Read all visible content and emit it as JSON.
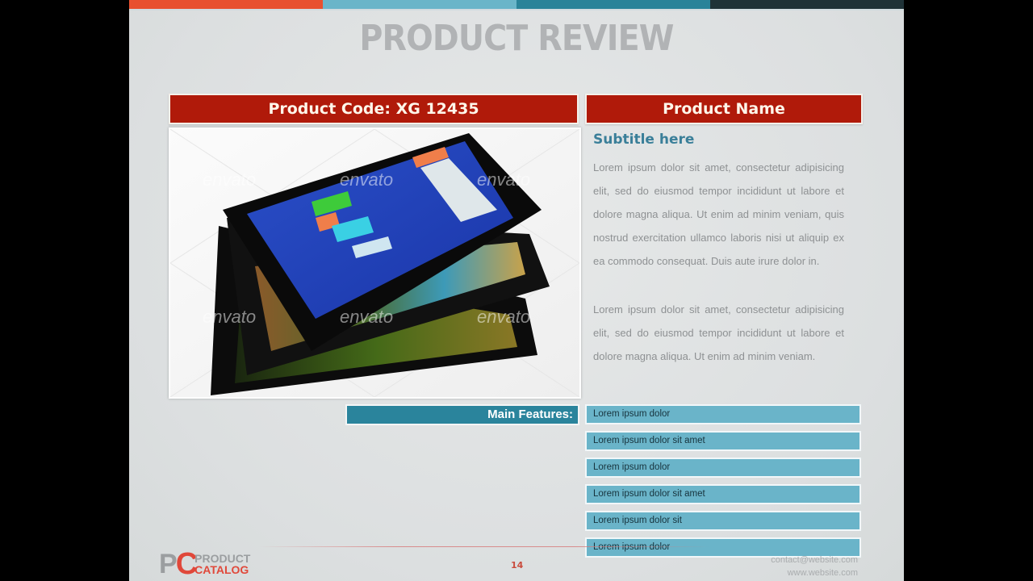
{
  "slide": {
    "title": "PRODUCT REVIEW",
    "top_bar_colors": [
      "#e8502f",
      "#6ab5c9",
      "#2a8399",
      "#1f3237"
    ],
    "product_code_label": "Product Code: XG 12435",
    "product_name_label": "Product Name",
    "subtitle": "Subtitle here",
    "paragraphs": [
      "Lorem ipsum dolor sit amet, consectetur adipisicing elit, sed do eiusmod tempor incididunt ut labore et dolore magna aliqua. Ut enim ad minim veniam, quis nostrud exercitation ullamco laboris nisi ut aliquip ex ea commodo consequat. Duis aute irure dolor in.",
      "Lorem ipsum dolor sit amet, consectetur adipisicing elit, sed do eiusmod tempor incididunt ut labore et dolore magna aliqua. Ut enim ad minim veniam."
    ],
    "image": {
      "description": "Stack of black tablets with Windows 8 start screen",
      "watermark": "envato"
    },
    "features_label": "Main Features:",
    "features": [
      "Lorem  ipsum dolor",
      "Lorem  ipsum dolor sit amet",
      "Lorem  ipsum dolor",
      "Lorem  ipsum dolor sit amet",
      "Lorem  ipsum dolor sit",
      "Lorem  ipsum dolor"
    ]
  },
  "footer": {
    "logo_p": "P",
    "logo_c": "C",
    "logo_word1": "PRODUCT",
    "logo_word2": "CATALOG",
    "page_number": "14",
    "email": "contact@website.com",
    "website": "www.website.com"
  },
  "colors": {
    "header_red": "#b01a0a",
    "accent_teal": "#2a849c",
    "feature_blue": "#6ab4c9",
    "subtitle_blue": "#3a7f99"
  }
}
